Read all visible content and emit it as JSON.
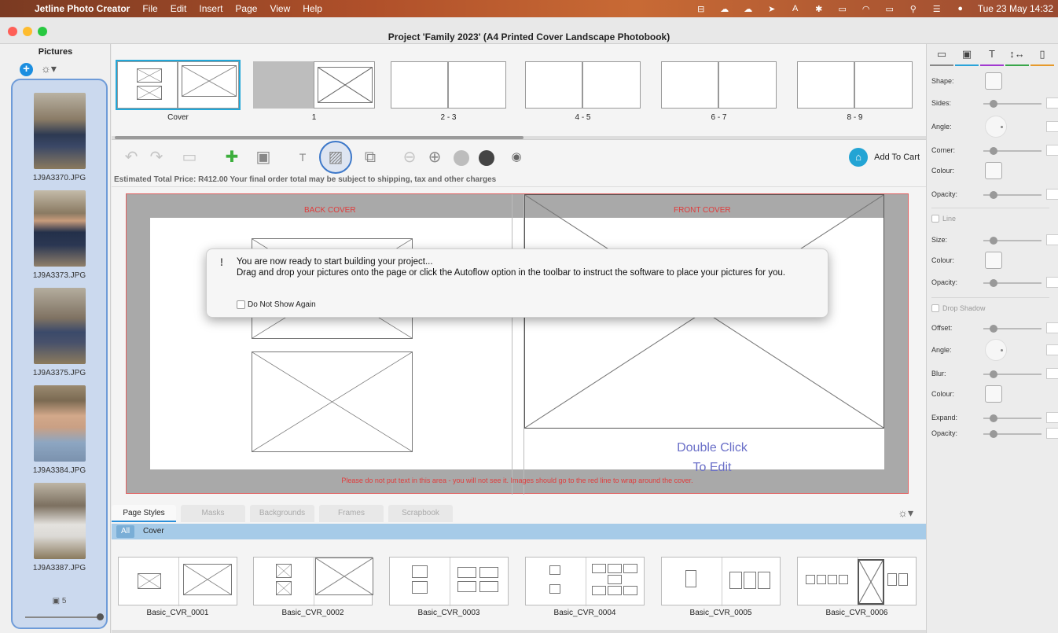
{
  "menubar": {
    "app_name": "Jetline Photo Creator",
    "menus": [
      "File",
      "Edit",
      "Insert",
      "Page",
      "View",
      "Help"
    ],
    "clock": "Tue 23 May  14:32"
  },
  "window": {
    "title": "Project 'Family 2023' (A4 Printed Cover Landscape Photobook)"
  },
  "sidebar": {
    "header": "Pictures",
    "pictures": [
      {
        "filename": "1J9A3370.JPG"
      },
      {
        "filename": "1J9A3373.JPG"
      },
      {
        "filename": "1J9A3375.JPG"
      },
      {
        "filename": "1J9A3384.JPG"
      },
      {
        "filename": "1J9A3387.JPG"
      }
    ],
    "picture_count": "5"
  },
  "spreads": [
    {
      "label": "Cover"
    },
    {
      "label": "1"
    },
    {
      "label": "2 - 3"
    },
    {
      "label": "4 - 5"
    },
    {
      "label": "6 - 7"
    },
    {
      "label": "8 - 9"
    }
  ],
  "toolbar": {
    "add_to_cart": "Add To Cart",
    "icons": [
      "undo-icon",
      "redo-icon",
      "save-icon",
      "add-page-icon",
      "add-picture-box-icon",
      "add-text-box-icon",
      "autoflow-icon",
      "page-layout-icon",
      "zoom-out-icon",
      "zoom-in-icon",
      "previous-page-icon",
      "next-page-icon",
      "preview-eye-icon"
    ]
  },
  "price": {
    "text": "Estimated Total Price: R412.00   Your final order total may be subject to shipping, tax and other charges"
  },
  "cover": {
    "back_label": "BACK COVER",
    "front_label": "FRONT COVER",
    "placeholder_line1": "Double Click",
    "placeholder_line2": "To Edit",
    "note": "Please do not put text in this area - you will not see it. Images should go to the red line to wrap around the cover."
  },
  "dialog": {
    "line1": "You are now ready to start building your project...",
    "line2": "Drag and drop your pictures onto the page or click the Autoflow option in the toolbar to instruct the software to place your pictures for you.",
    "checkbox_label": "Do Not Show Again",
    "checkbox_checked": false
  },
  "bottom": {
    "tabs": [
      "Page Styles",
      "Masks",
      "Backgrounds",
      "Frames",
      "Scrapbook"
    ],
    "active_tab": "Page Styles",
    "filters": [
      "All",
      "Cover"
    ],
    "active_filter": "All",
    "styles": [
      {
        "name": "Basic_CVR_0001"
      },
      {
        "name": "Basic_CVR_0002"
      },
      {
        "name": "Basic_CVR_0003"
      },
      {
        "name": "Basic_CVR_0004"
      },
      {
        "name": "Basic_CVR_0005"
      },
      {
        "name": "Basic_CVR_0006"
      }
    ]
  },
  "properties": {
    "shape": "Shape:",
    "sides": "Sides:",
    "angle": "Angle:",
    "corner": "Corner:",
    "colour": "Colour:",
    "opacity": "Opacity:",
    "line_section": "Line",
    "line_size": "Size:",
    "line_colour": "Colour:",
    "line_opacity": "Opacity:",
    "shadow_section": "Drop Shadow",
    "shadow_offset": "Offset:",
    "shadow_angle": "Angle:",
    "shadow_blur": "Blur:",
    "shadow_colour": "Colour:",
    "shadow_expand": "Expand:",
    "shadow_opacity": "Opacity:"
  },
  "colors": {
    "accent": "#2b8fd9",
    "selection_border": "#3d78c9",
    "warning_text": "#e03c3c",
    "placeholder_text": "#6a6fc8"
  }
}
